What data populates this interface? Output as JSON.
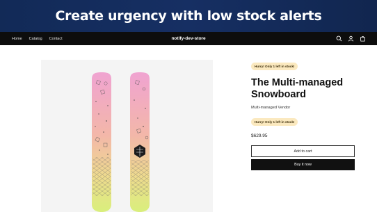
{
  "banner": {
    "title": "Create urgency with low stock alerts"
  },
  "nav": {
    "links": [
      "Home",
      "Catalog",
      "Contact"
    ],
    "brand": "notify-dev-store",
    "icons": [
      "search-icon",
      "account-icon",
      "cart-icon"
    ]
  },
  "product": {
    "stock_badge": "Hurry! Only 1 left in stock!",
    "title_line1": "The Multi-managed",
    "title_line2": "Snowboard",
    "vendor": "Multi-managed Vendor",
    "stock_badge_2": "Hurry! Only 1 left in stock!",
    "price": "$629.95",
    "add_to_cart": "Add to cart",
    "buy_now": "Buy it now"
  },
  "colors": {
    "banner_bg": "#142c5c",
    "nav_bg": "#0d0d0d",
    "badge_bg": "#fbe9bf",
    "board_pink": "#f2a6cf",
    "board_yellow": "#e8f088"
  }
}
